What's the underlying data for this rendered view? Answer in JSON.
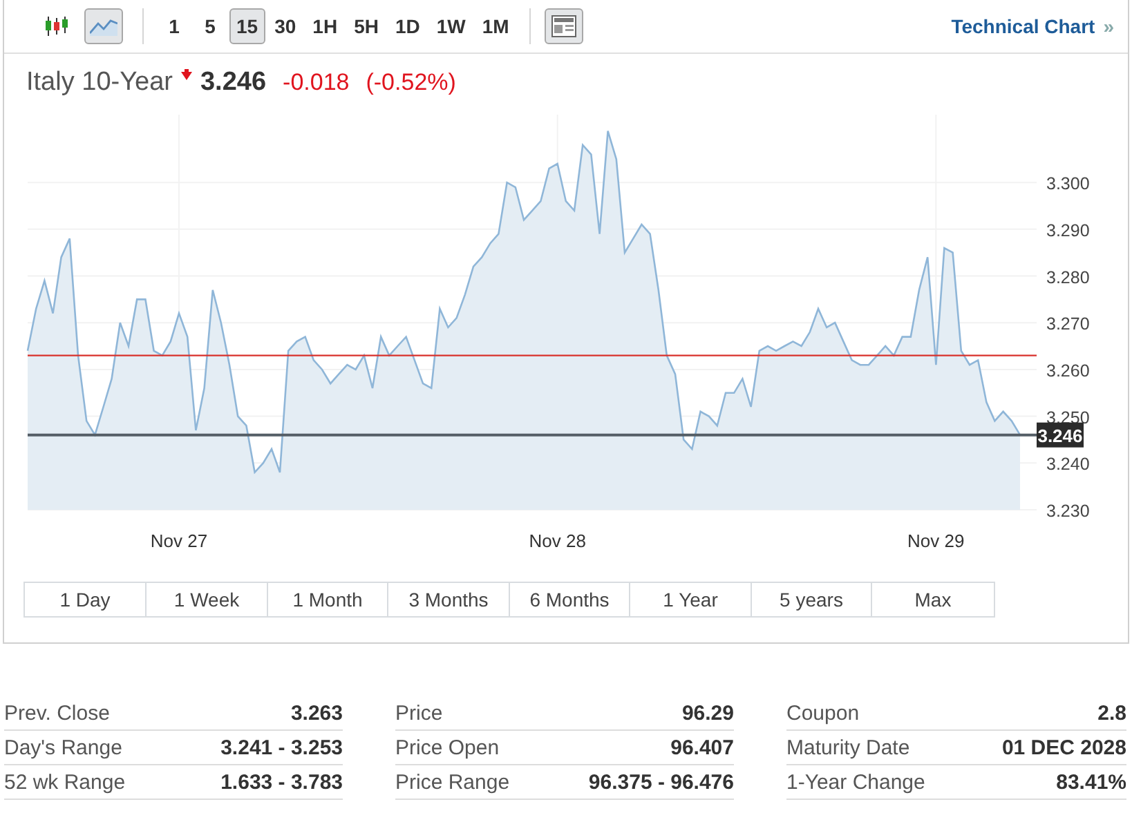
{
  "toolbar": {
    "chart_types": [
      {
        "kind": "candles",
        "selected": false
      },
      {
        "kind": "line",
        "selected": true
      }
    ],
    "intervals": [
      {
        "label": "1",
        "selected": false
      },
      {
        "label": "5",
        "selected": false
      },
      {
        "label": "15",
        "selected": true
      },
      {
        "label": "30",
        "selected": false
      },
      {
        "label": "1H",
        "selected": false
      },
      {
        "label": "5H",
        "selected": false
      },
      {
        "label": "1D",
        "selected": false
      },
      {
        "label": "1W",
        "selected": false
      },
      {
        "label": "1M",
        "selected": false
      }
    ],
    "link": "Technical Chart",
    "link_glyph": "»"
  },
  "header": {
    "name": "Italy 10-Year",
    "price": "3.246",
    "change": "-0.018",
    "change_pct": "(-0.52%)"
  },
  "chart": {
    "chart_data": {
      "type": "area",
      "categories": [
        null,
        null,
        null,
        null,
        null,
        null,
        null,
        null,
        null,
        null,
        null,
        null,
        null,
        null,
        null,
        null,
        null,
        null,
        "Nov 27",
        null,
        null,
        null,
        null,
        null,
        null,
        null,
        null,
        null,
        null,
        null,
        null,
        null,
        null,
        null,
        null,
        null,
        null,
        null,
        null,
        null,
        null,
        null,
        null,
        null,
        null,
        null,
        null,
        null,
        null,
        null,
        null,
        null,
        null,
        null,
        null,
        null,
        null,
        null,
        null,
        null,
        null,
        null,
        null,
        "Nov 28",
        null,
        null,
        null,
        null,
        null,
        null,
        null,
        null,
        null,
        null,
        null,
        null,
        null,
        null,
        null,
        null,
        null,
        null,
        null,
        null,
        null,
        null,
        null,
        null,
        null,
        null,
        null,
        null,
        null,
        null,
        null,
        null,
        null,
        null,
        null,
        null,
        null,
        null,
        null,
        null,
        null,
        null,
        null,
        null,
        "Nov 29",
        null,
        null,
        null,
        null,
        null,
        null,
        null,
        null,
        null,
        null
      ],
      "series": [
        {
          "color": "#8fb6d8",
          "values": [
            3.264,
            3.273,
            3.279,
            3.272,
            3.284,
            3.288,
            3.263,
            3.249,
            3.246,
            3.252,
            3.258,
            3.27,
            3.265,
            3.275,
            3.275,
            3.264,
            3.263,
            3.266,
            3.272,
            3.267,
            3.247,
            3.256,
            3.277,
            3.27,
            3.261,
            3.25,
            3.248,
            3.238,
            3.24,
            3.243,
            3.238,
            3.264,
            3.266,
            3.267,
            3.262,
            3.26,
            3.257,
            3.259,
            3.261,
            3.26,
            3.263,
            3.256,
            3.267,
            3.263,
            3.265,
            3.267,
            3.262,
            3.257,
            3.256,
            3.273,
            3.269,
            3.271,
            3.276,
            3.282,
            3.284,
            3.287,
            3.289,
            3.3,
            3.299,
            3.292,
            3.294,
            3.296,
            3.303,
            3.304,
            3.296,
            3.294,
            3.308,
            3.306,
            3.289,
            3.311,
            3.305,
            3.285,
            3.288,
            3.291,
            3.289,
            3.277,
            3.263,
            3.259,
            3.245,
            3.243,
            3.251,
            3.25,
            3.248,
            3.255,
            3.255,
            3.258,
            3.252,
            3.264,
            3.265,
            3.264,
            3.265,
            3.266,
            3.265,
            3.268,
            3.273,
            3.269,
            3.27,
            3.266,
            3.262,
            3.261,
            3.261,
            3.263,
            3.265,
            3.263,
            3.267,
            3.267,
            3.277,
            3.284,
            3.261,
            3.286,
            3.285,
            3.264,
            3.261,
            3.262,
            3.253,
            3.249,
            3.251,
            3.249,
            3.246
          ]
        }
      ],
      "ylim": [
        3.23,
        3.3145
      ],
      "grid": true,
      "yticks": [
        {
          "value": 3.23,
          "label": "3.230"
        },
        {
          "value": 3.24,
          "label": "3.240"
        },
        {
          "value": 3.25,
          "label": "3.250"
        },
        {
          "value": 3.26,
          "label": "3.260"
        },
        {
          "value": 3.27,
          "label": "3.270"
        },
        {
          "value": 3.28,
          "label": "3.280"
        },
        {
          "value": 3.29,
          "label": "3.290"
        },
        {
          "value": 3.3,
          "label": "3.300"
        }
      ],
      "ref_lines": [
        {
          "axis": "y",
          "value": 3.263,
          "color": "#d9312b"
        },
        {
          "axis": "y",
          "value": 3.246,
          "color": "#555e66",
          "label": "3.246"
        }
      ]
    }
  },
  "ranges": [
    {
      "label": "1 Day",
      "selected": false
    },
    {
      "label": "1 Week",
      "selected": false
    },
    {
      "label": "1 Month",
      "selected": false
    },
    {
      "label": "3 Months",
      "selected": false
    },
    {
      "label": "6 Months",
      "selected": false
    },
    {
      "label": "1 Year",
      "selected": false
    },
    {
      "label": "5 years",
      "selected": false
    },
    {
      "label": "Max",
      "selected": false
    }
  ],
  "stats": [
    [
      {
        "label": "Prev. Close",
        "value": "3.263"
      },
      {
        "label": "Day's Range",
        "value": "3.241 - 3.253"
      },
      {
        "label": "52 wk Range",
        "value": "1.633 - 3.783"
      }
    ],
    [
      {
        "label": "Price",
        "value": "96.29"
      },
      {
        "label": "Price Open",
        "value": "96.407"
      },
      {
        "label": "Price Range",
        "value": "96.375 - 96.476"
      }
    ],
    [
      {
        "label": "Coupon",
        "value": "2.8"
      },
      {
        "label": "Maturity Date",
        "value": "01 DEC 2028"
      },
      {
        "label": "1-Year Change",
        "value": "83.41%"
      }
    ]
  ]
}
